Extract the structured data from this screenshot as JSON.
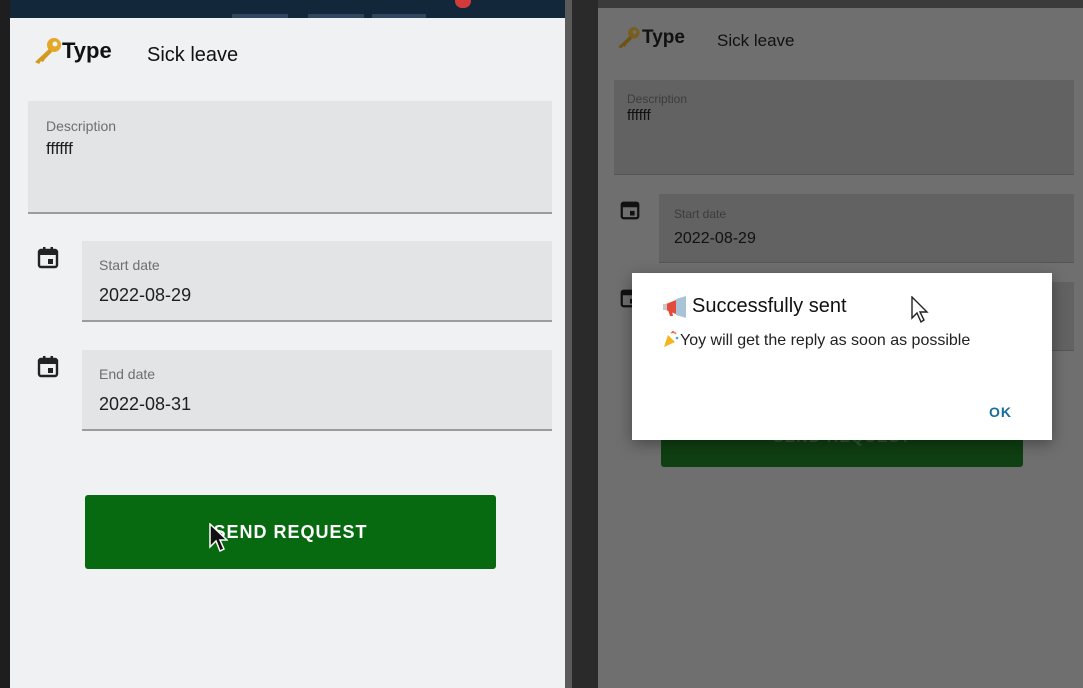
{
  "form": {
    "type_label": "Type",
    "type_value": "Sick leave",
    "description_label": "Description",
    "description_value": "ffffff",
    "start_label": "Start date",
    "start_value": "2022-08-29",
    "end_label": "End date",
    "end_value": "2022-08-31",
    "send_button": "SEND REQUEST"
  },
  "dialog": {
    "title": "Successfully sent",
    "message": "Yoy will get the reply as soon as possible",
    "ok": "OK"
  },
  "colors": {
    "accent": "#076a10",
    "dialog_button": "#1a6c9b"
  },
  "icons": [
    "key-icon",
    "calendar-icon",
    "megaphone-icon",
    "party-icon",
    "pointer-cursor-icon"
  ]
}
